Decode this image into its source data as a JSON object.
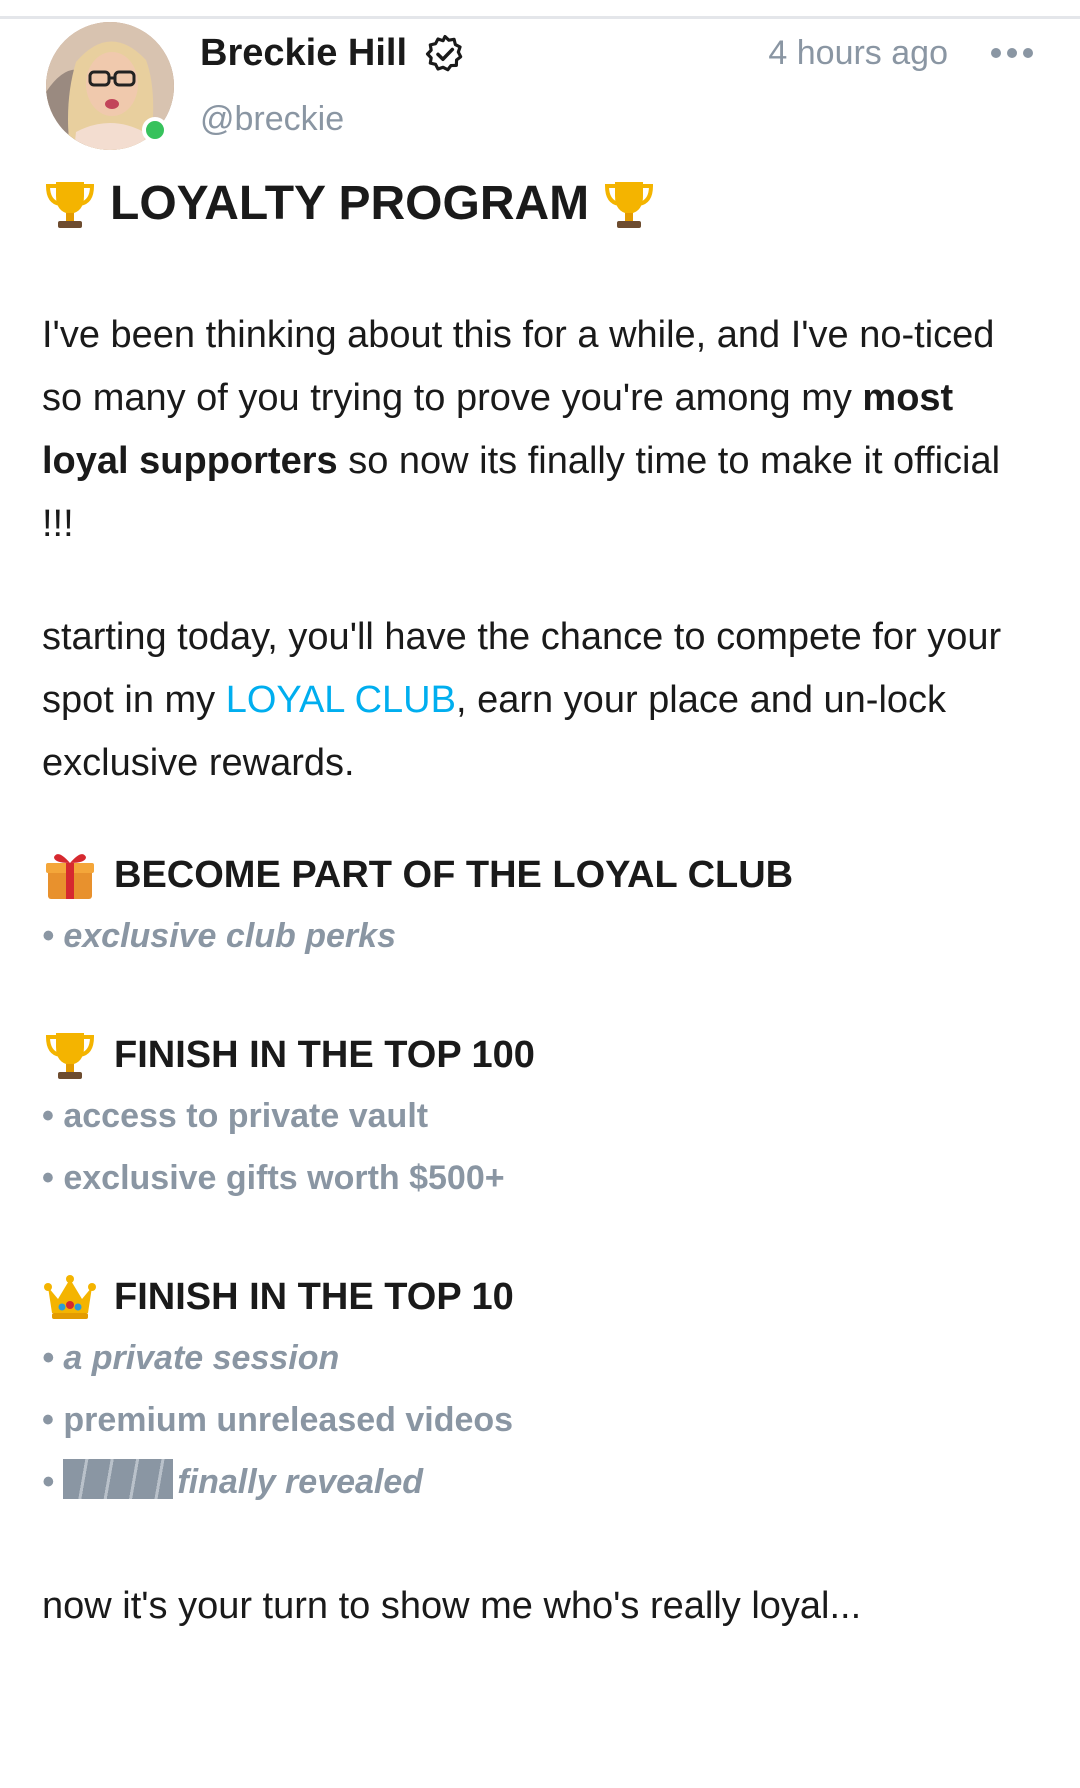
{
  "post": {
    "author": {
      "display_name": "Breckie Hill",
      "username": "@breckie",
      "verified": true,
      "online": true
    },
    "timestamp": "4 hours ago",
    "menu_icon": "more-horizontal-icon",
    "title": "LOYALTY PROGRAM",
    "title_icon": "trophy-icon",
    "paragraph1": {
      "part1": "I've been thinking about this for a while, and I've no-ticed so many of you trying to prove you're among my ",
      "bold": "most loyal supporters",
      "part2": " so now its finally time to make it official !!!"
    },
    "paragraph2": {
      "part1": "starting today, you'll have the chance to compete for your spot in my ",
      "link": "LOYAL CLUB",
      "part2": ", earn your place and un-lock exclusive rewards."
    },
    "sections": [
      {
        "icon": "gift-icon",
        "heading": "BECOME PART OF THE LOYAL CLUB",
        "bullets": [
          "• exclusive club perks"
        ]
      },
      {
        "icon": "trophy-icon",
        "heading": "FINISH IN THE TOP 100",
        "bullets": [
          "• access to private vault",
          "• exclusive gifts worth $500+"
        ]
      },
      {
        "icon": "crown-icon",
        "heading": "FINISH IN THE TOP 10",
        "bullets": [
          "• a private session",
          "• premium unreleased videos",
          "finally revealed"
        ]
      }
    ],
    "closing": "now it's your turn to show me who's really loyal...",
    "colors": {
      "link": "#00aeef",
      "muted": "#8a96a3",
      "online": "#37c25c",
      "text": "#1a1a1a"
    }
  }
}
